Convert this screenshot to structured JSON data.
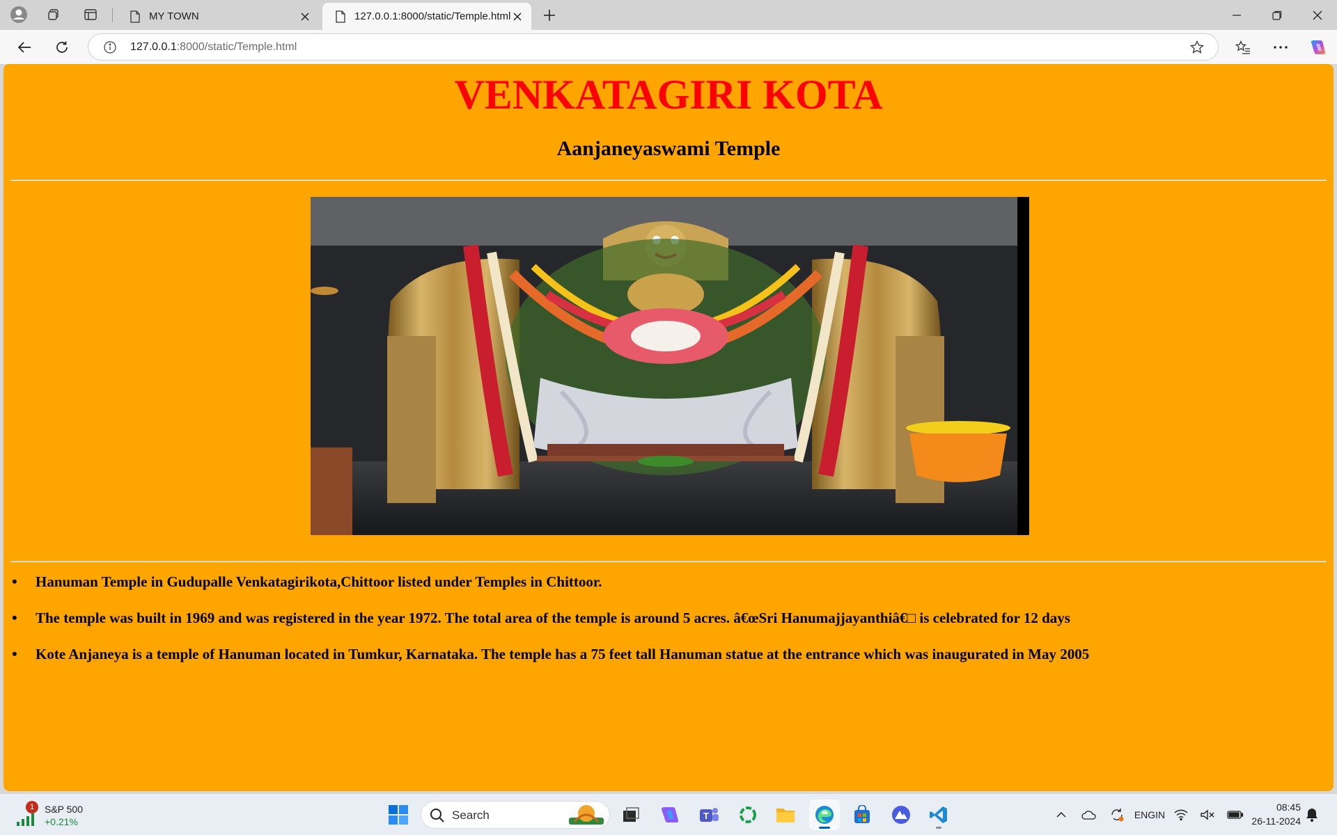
{
  "browser": {
    "tabs": [
      {
        "title": "MY TOWN",
        "active": false
      },
      {
        "title": "127.0.0.1:8000/static/Temple.html",
        "active": true
      }
    ],
    "address": {
      "host": "127.0.0.1",
      "rest": ":8000/static/Temple.html"
    }
  },
  "page": {
    "title": "VENKATAGIRI KOTA",
    "subtitle": "Aanjaneyaswami Temple",
    "background_color": "#ffa500",
    "title_color": "#ff0000",
    "facts": [
      "Hanuman Temple in Gudupalle Venkatagirikota,Chittoor listed under Temples in Chittoor.",
      "The temple was built in 1969 and was registered in the year 1972. The total area of the temple is around 5 acres. â€œSri Hanumajjayanthiâ€□ is celebrated for 12 days",
      "Kote Anjaneya is a temple of Hanuman located in Tumkur, Karnataka. The temple has a 75 feet tall Hanuman statue at the entrance which was inaugurated in May 2005"
    ]
  },
  "taskbar": {
    "widget": {
      "badge": "1",
      "name": "S&P 500",
      "change": "+0.21%"
    },
    "search_placeholder": "Search",
    "language": {
      "line1": "ENG",
      "line2": "IN"
    },
    "time": "08:45",
    "date": "26-11-2024"
  }
}
